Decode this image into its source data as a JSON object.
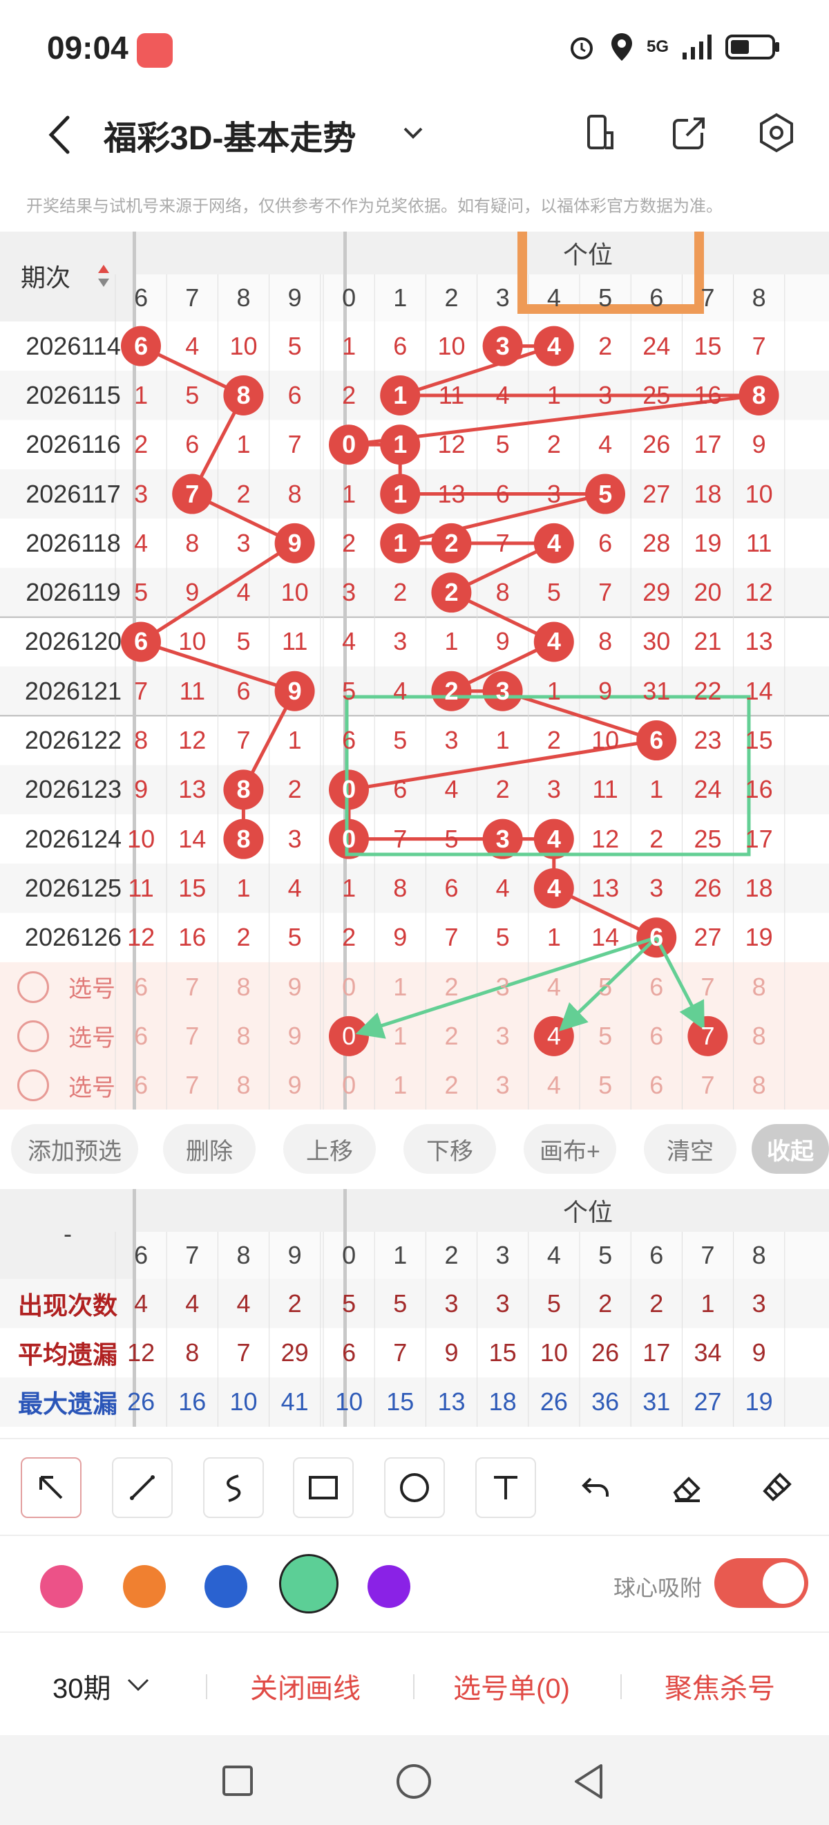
{
  "status": {
    "time": "09:04",
    "network": "5G"
  },
  "header": {
    "title": "福彩3D-基本走势"
  },
  "notice": "开奖结果与试机号来源于网络，仅供参考不作为兑奖依据。如有疑问，以福体彩官方数据为准。",
  "table": {
    "issue_header": "期次",
    "group_label": "个位",
    "left_cols": [
      "6",
      "7",
      "8",
      "9"
    ],
    "right_cols": [
      "0",
      "1",
      "2",
      "3",
      "4",
      "5",
      "6",
      "7",
      "8"
    ],
    "rows": [
      {
        "issue": "2026114",
        "left": [
          "6",
          "4",
          "10",
          "5"
        ],
        "right": [
          "1",
          "6",
          "10",
          "3",
          "4",
          "2",
          "24",
          "15",
          "7"
        ]
      },
      {
        "issue": "2026115",
        "left": [
          "1",
          "5",
          "8",
          "6"
        ],
        "right": [
          "2",
          "1",
          "11",
          "4",
          "1",
          "3",
          "25",
          "16",
          "8"
        ]
      },
      {
        "issue": "2026116",
        "left": [
          "2",
          "6",
          "1",
          "7"
        ],
        "right": [
          "0",
          "1",
          "12",
          "5",
          "2",
          "4",
          "26",
          "17",
          "9"
        ]
      },
      {
        "issue": "2026117",
        "left": [
          "3",
          "7",
          "2",
          "8"
        ],
        "right": [
          "1",
          "1",
          "13",
          "6",
          "3",
          "5",
          "27",
          "18",
          "10"
        ]
      },
      {
        "issue": "2026118",
        "left": [
          "4",
          "8",
          "3",
          "9"
        ],
        "right": [
          "2",
          "1",
          "2",
          "7",
          "4",
          "6",
          "28",
          "19",
          "11"
        ]
      },
      {
        "issue": "2026119",
        "left": [
          "5",
          "9",
          "4",
          "10"
        ],
        "right": [
          "3",
          "2",
          "2",
          "8",
          "5",
          "7",
          "29",
          "20",
          "12"
        ]
      },
      {
        "issue": "2026120",
        "left": [
          "6",
          "10",
          "5",
          "11"
        ],
        "right": [
          "4",
          "3",
          "1",
          "9",
          "4",
          "8",
          "30",
          "21",
          "13"
        ]
      },
      {
        "issue": "2026121",
        "left": [
          "7",
          "11",
          "6",
          "9"
        ],
        "right": [
          "5",
          "4",
          "2",
          "3",
          "1",
          "9",
          "31",
          "22",
          "14"
        ]
      },
      {
        "issue": "2026122",
        "left": [
          "8",
          "12",
          "7",
          "1"
        ],
        "right": [
          "6",
          "5",
          "3",
          "1",
          "2",
          "10",
          "6",
          "23",
          "15"
        ]
      },
      {
        "issue": "2026123",
        "left": [
          "9",
          "13",
          "8",
          "2"
        ],
        "right": [
          "0",
          "6",
          "4",
          "2",
          "3",
          "11",
          "1",
          "24",
          "16"
        ]
      },
      {
        "issue": "2026124",
        "left": [
          "10",
          "14",
          "8",
          "3"
        ],
        "right": [
          "0",
          "7",
          "5",
          "3",
          "4",
          "12",
          "2",
          "25",
          "17"
        ]
      },
      {
        "issue": "2026125",
        "left": [
          "11",
          "15",
          "1",
          "4"
        ],
        "right": [
          "1",
          "8",
          "6",
          "4",
          "4",
          "13",
          "3",
          "26",
          "18"
        ]
      },
      {
        "issue": "2026126",
        "left": [
          "12",
          "16",
          "2",
          "5"
        ],
        "right": [
          "2",
          "9",
          "7",
          "5",
          "1",
          "14",
          "6",
          "27",
          "19"
        ]
      }
    ],
    "select_rows": [
      {
        "label": "选号",
        "left": [
          "6",
          "7",
          "8",
          "9"
        ],
        "right": [
          "0",
          "1",
          "2",
          "3",
          "4",
          "5",
          "6",
          "7",
          "8"
        ]
      },
      {
        "label": "选号",
        "left": [
          "6",
          "7",
          "8",
          "9"
        ],
        "right": [
          "0",
          "1",
          "2",
          "3",
          "4",
          "5",
          "6",
          "7",
          "8"
        ]
      },
      {
        "label": "选号",
        "left": [
          "6",
          "7",
          "8",
          "9"
        ],
        "right": [
          "0",
          "1",
          "2",
          "3",
          "4",
          "5",
          "6",
          "7",
          "8"
        ]
      }
    ]
  },
  "buttons": [
    "添加预选",
    "删除",
    "上移",
    "下移",
    "画布+",
    "清空",
    "收起"
  ],
  "stats": {
    "corner": "-",
    "group_label": "个位",
    "left_cols": [
      "6",
      "7",
      "8",
      "9"
    ],
    "right_cols": [
      "0",
      "1",
      "2",
      "3",
      "4",
      "5",
      "6",
      "7",
      "8"
    ],
    "rows": [
      {
        "label": "出现次数",
        "left": [
          "4",
          "4",
          "4",
          "2"
        ],
        "right": [
          "5",
          "5",
          "3",
          "3",
          "5",
          "2",
          "2",
          "1",
          "3"
        ]
      },
      {
        "label": "平均遗漏",
        "left": [
          "12",
          "8",
          "7",
          "29"
        ],
        "right": [
          "6",
          "7",
          "9",
          "15",
          "10",
          "26",
          "17",
          "34",
          "9"
        ]
      },
      {
        "label": "最大遗漏",
        "left": [
          "26",
          "16",
          "10",
          "41"
        ],
        "right": [
          "10",
          "15",
          "13",
          "18",
          "26",
          "36",
          "31",
          "27",
          "19"
        ]
      }
    ]
  },
  "colors": {
    "accent": "#e04a45",
    "pink": "#ec5288",
    "orange": "#f08030",
    "blue": "#2a62d0",
    "green": "#5ccf96",
    "purple": "#8a22e6",
    "frame_orange": "#ee9a56",
    "frame_green": "#63cf94"
  },
  "snap_label": "球心吸附",
  "bottom": {
    "period": "30期",
    "close_lines": "关闭画线",
    "pick_list": "选号单(0)",
    "focus_kill": "聚焦杀号"
  }
}
